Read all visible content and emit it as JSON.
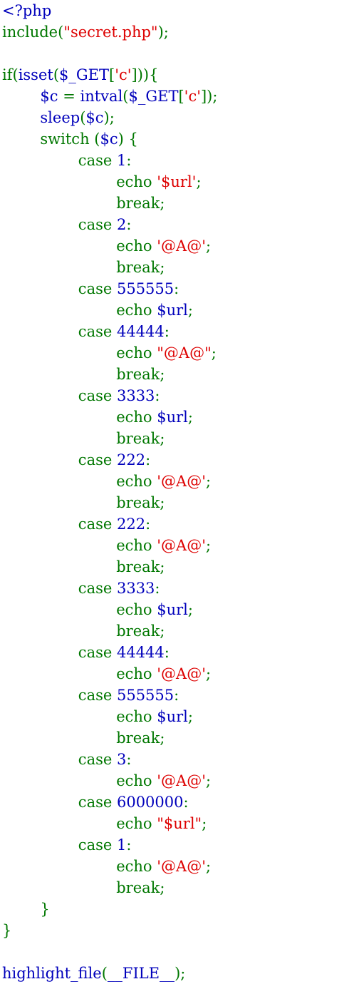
{
  "colors": {
    "default": "#000000",
    "keyword": "#007700",
    "variable": "#0000BB",
    "string": "#DD0000"
  },
  "lines": [
    [
      {
        "t": "<?php",
        "c": "variable"
      }
    ],
    [
      {
        "t": "include(",
        "c": "keyword"
      },
      {
        "t": "\"secret.php\"",
        "c": "string"
      },
      {
        "t": ");",
        "c": "keyword"
      }
    ],
    [],
    [
      {
        "t": "if(",
        "c": "keyword"
      },
      {
        "t": "isset",
        "c": "variable"
      },
      {
        "t": "(",
        "c": "keyword"
      },
      {
        "t": "$_GET",
        "c": "variable"
      },
      {
        "t": "[",
        "c": "keyword"
      },
      {
        "t": "'c'",
        "c": "string"
      },
      {
        "t": "])){",
        "c": "keyword"
      }
    ],
    [
      {
        "t": "        ",
        "c": "keyword"
      },
      {
        "t": "$c ",
        "c": "variable"
      },
      {
        "t": "= ",
        "c": "keyword"
      },
      {
        "t": "intval",
        "c": "variable"
      },
      {
        "t": "(",
        "c": "keyword"
      },
      {
        "t": "$_GET",
        "c": "variable"
      },
      {
        "t": "[",
        "c": "keyword"
      },
      {
        "t": "'c'",
        "c": "string"
      },
      {
        "t": "]);",
        "c": "keyword"
      }
    ],
    [
      {
        "t": "        ",
        "c": "keyword"
      },
      {
        "t": "sleep",
        "c": "variable"
      },
      {
        "t": "(",
        "c": "keyword"
      },
      {
        "t": "$c",
        "c": "variable"
      },
      {
        "t": ");",
        "c": "keyword"
      }
    ],
    [
      {
        "t": "        switch ",
        "c": "keyword"
      },
      {
        "t": "(",
        "c": "keyword"
      },
      {
        "t": "$c",
        "c": "variable"
      },
      {
        "t": ") {",
        "c": "keyword"
      }
    ],
    [
      {
        "t": "                case ",
        "c": "keyword"
      },
      {
        "t": "1",
        "c": "variable"
      },
      {
        "t": ":",
        "c": "keyword"
      }
    ],
    [
      {
        "t": "                        echo ",
        "c": "keyword"
      },
      {
        "t": "'$url'",
        "c": "string"
      },
      {
        "t": ";",
        "c": "keyword"
      }
    ],
    [
      {
        "t": "                        break;",
        "c": "keyword"
      }
    ],
    [
      {
        "t": "                case ",
        "c": "keyword"
      },
      {
        "t": "2",
        "c": "variable"
      },
      {
        "t": ":",
        "c": "keyword"
      }
    ],
    [
      {
        "t": "                        echo ",
        "c": "keyword"
      },
      {
        "t": "'@A@'",
        "c": "string"
      },
      {
        "t": ";",
        "c": "keyword"
      }
    ],
    [
      {
        "t": "                        break;",
        "c": "keyword"
      }
    ],
    [
      {
        "t": "                case ",
        "c": "keyword"
      },
      {
        "t": "555555",
        "c": "variable"
      },
      {
        "t": ":",
        "c": "keyword"
      }
    ],
    [
      {
        "t": "                        echo ",
        "c": "keyword"
      },
      {
        "t": "$url",
        "c": "variable"
      },
      {
        "t": ";",
        "c": "keyword"
      }
    ],
    [
      {
        "t": "                case ",
        "c": "keyword"
      },
      {
        "t": "44444",
        "c": "variable"
      },
      {
        "t": ":",
        "c": "keyword"
      }
    ],
    [
      {
        "t": "                        echo ",
        "c": "keyword"
      },
      {
        "t": "\"@A@\"",
        "c": "string"
      },
      {
        "t": ";",
        "c": "keyword"
      }
    ],
    [
      {
        "t": "                        break;",
        "c": "keyword"
      }
    ],
    [
      {
        "t": "                case ",
        "c": "keyword"
      },
      {
        "t": "3333",
        "c": "variable"
      },
      {
        "t": ":",
        "c": "keyword"
      }
    ],
    [
      {
        "t": "                        echo ",
        "c": "keyword"
      },
      {
        "t": "$url",
        "c": "variable"
      },
      {
        "t": ";",
        "c": "keyword"
      }
    ],
    [
      {
        "t": "                        break;",
        "c": "keyword"
      }
    ],
    [
      {
        "t": "                case ",
        "c": "keyword"
      },
      {
        "t": "222",
        "c": "variable"
      },
      {
        "t": ":",
        "c": "keyword"
      }
    ],
    [
      {
        "t": "                        echo ",
        "c": "keyword"
      },
      {
        "t": "'@A@'",
        "c": "string"
      },
      {
        "t": ";",
        "c": "keyword"
      }
    ],
    [
      {
        "t": "                        break;",
        "c": "keyword"
      }
    ],
    [
      {
        "t": "                case ",
        "c": "keyword"
      },
      {
        "t": "222",
        "c": "variable"
      },
      {
        "t": ":",
        "c": "keyword"
      }
    ],
    [
      {
        "t": "                        echo ",
        "c": "keyword"
      },
      {
        "t": "'@A@'",
        "c": "string"
      },
      {
        "t": ";",
        "c": "keyword"
      }
    ],
    [
      {
        "t": "                        break;",
        "c": "keyword"
      }
    ],
    [
      {
        "t": "                case ",
        "c": "keyword"
      },
      {
        "t": "3333",
        "c": "variable"
      },
      {
        "t": ":",
        "c": "keyword"
      }
    ],
    [
      {
        "t": "                        echo ",
        "c": "keyword"
      },
      {
        "t": "$url",
        "c": "variable"
      },
      {
        "t": ";",
        "c": "keyword"
      }
    ],
    [
      {
        "t": "                        break;",
        "c": "keyword"
      }
    ],
    [
      {
        "t": "                case ",
        "c": "keyword"
      },
      {
        "t": "44444",
        "c": "variable"
      },
      {
        "t": ":",
        "c": "keyword"
      }
    ],
    [
      {
        "t": "                        echo ",
        "c": "keyword"
      },
      {
        "t": "'@A@'",
        "c": "string"
      },
      {
        "t": ";",
        "c": "keyword"
      }
    ],
    [
      {
        "t": "                case ",
        "c": "keyword"
      },
      {
        "t": "555555",
        "c": "variable"
      },
      {
        "t": ":",
        "c": "keyword"
      }
    ],
    [
      {
        "t": "                        echo ",
        "c": "keyword"
      },
      {
        "t": "$url",
        "c": "variable"
      },
      {
        "t": ";",
        "c": "keyword"
      }
    ],
    [
      {
        "t": "                        break;",
        "c": "keyword"
      }
    ],
    [
      {
        "t": "                case ",
        "c": "keyword"
      },
      {
        "t": "3",
        "c": "variable"
      },
      {
        "t": ":",
        "c": "keyword"
      }
    ],
    [
      {
        "t": "                        echo ",
        "c": "keyword"
      },
      {
        "t": "'@A@'",
        "c": "string"
      },
      {
        "t": ";",
        "c": "keyword"
      }
    ],
    [
      {
        "t": "                case ",
        "c": "keyword"
      },
      {
        "t": "6000000",
        "c": "variable"
      },
      {
        "t": ":",
        "c": "keyword"
      }
    ],
    [
      {
        "t": "                        echo ",
        "c": "keyword"
      },
      {
        "t": "\"$url\"",
        "c": "string"
      },
      {
        "t": ";",
        "c": "keyword"
      }
    ],
    [
      {
        "t": "                case ",
        "c": "keyword"
      },
      {
        "t": "1",
        "c": "variable"
      },
      {
        "t": ":",
        "c": "keyword"
      }
    ],
    [
      {
        "t": "                        echo ",
        "c": "keyword"
      },
      {
        "t": "'@A@'",
        "c": "string"
      },
      {
        "t": ";",
        "c": "keyword"
      }
    ],
    [
      {
        "t": "                        break;",
        "c": "keyword"
      }
    ],
    [
      {
        "t": "        }",
        "c": "keyword"
      }
    ],
    [
      {
        "t": "}",
        "c": "keyword"
      }
    ],
    [],
    [
      {
        "t": "highlight_file",
        "c": "variable"
      },
      {
        "t": "(",
        "c": "keyword"
      },
      {
        "t": "__FILE__",
        "c": "variable"
      },
      {
        "t": ");",
        "c": "keyword"
      }
    ]
  ]
}
